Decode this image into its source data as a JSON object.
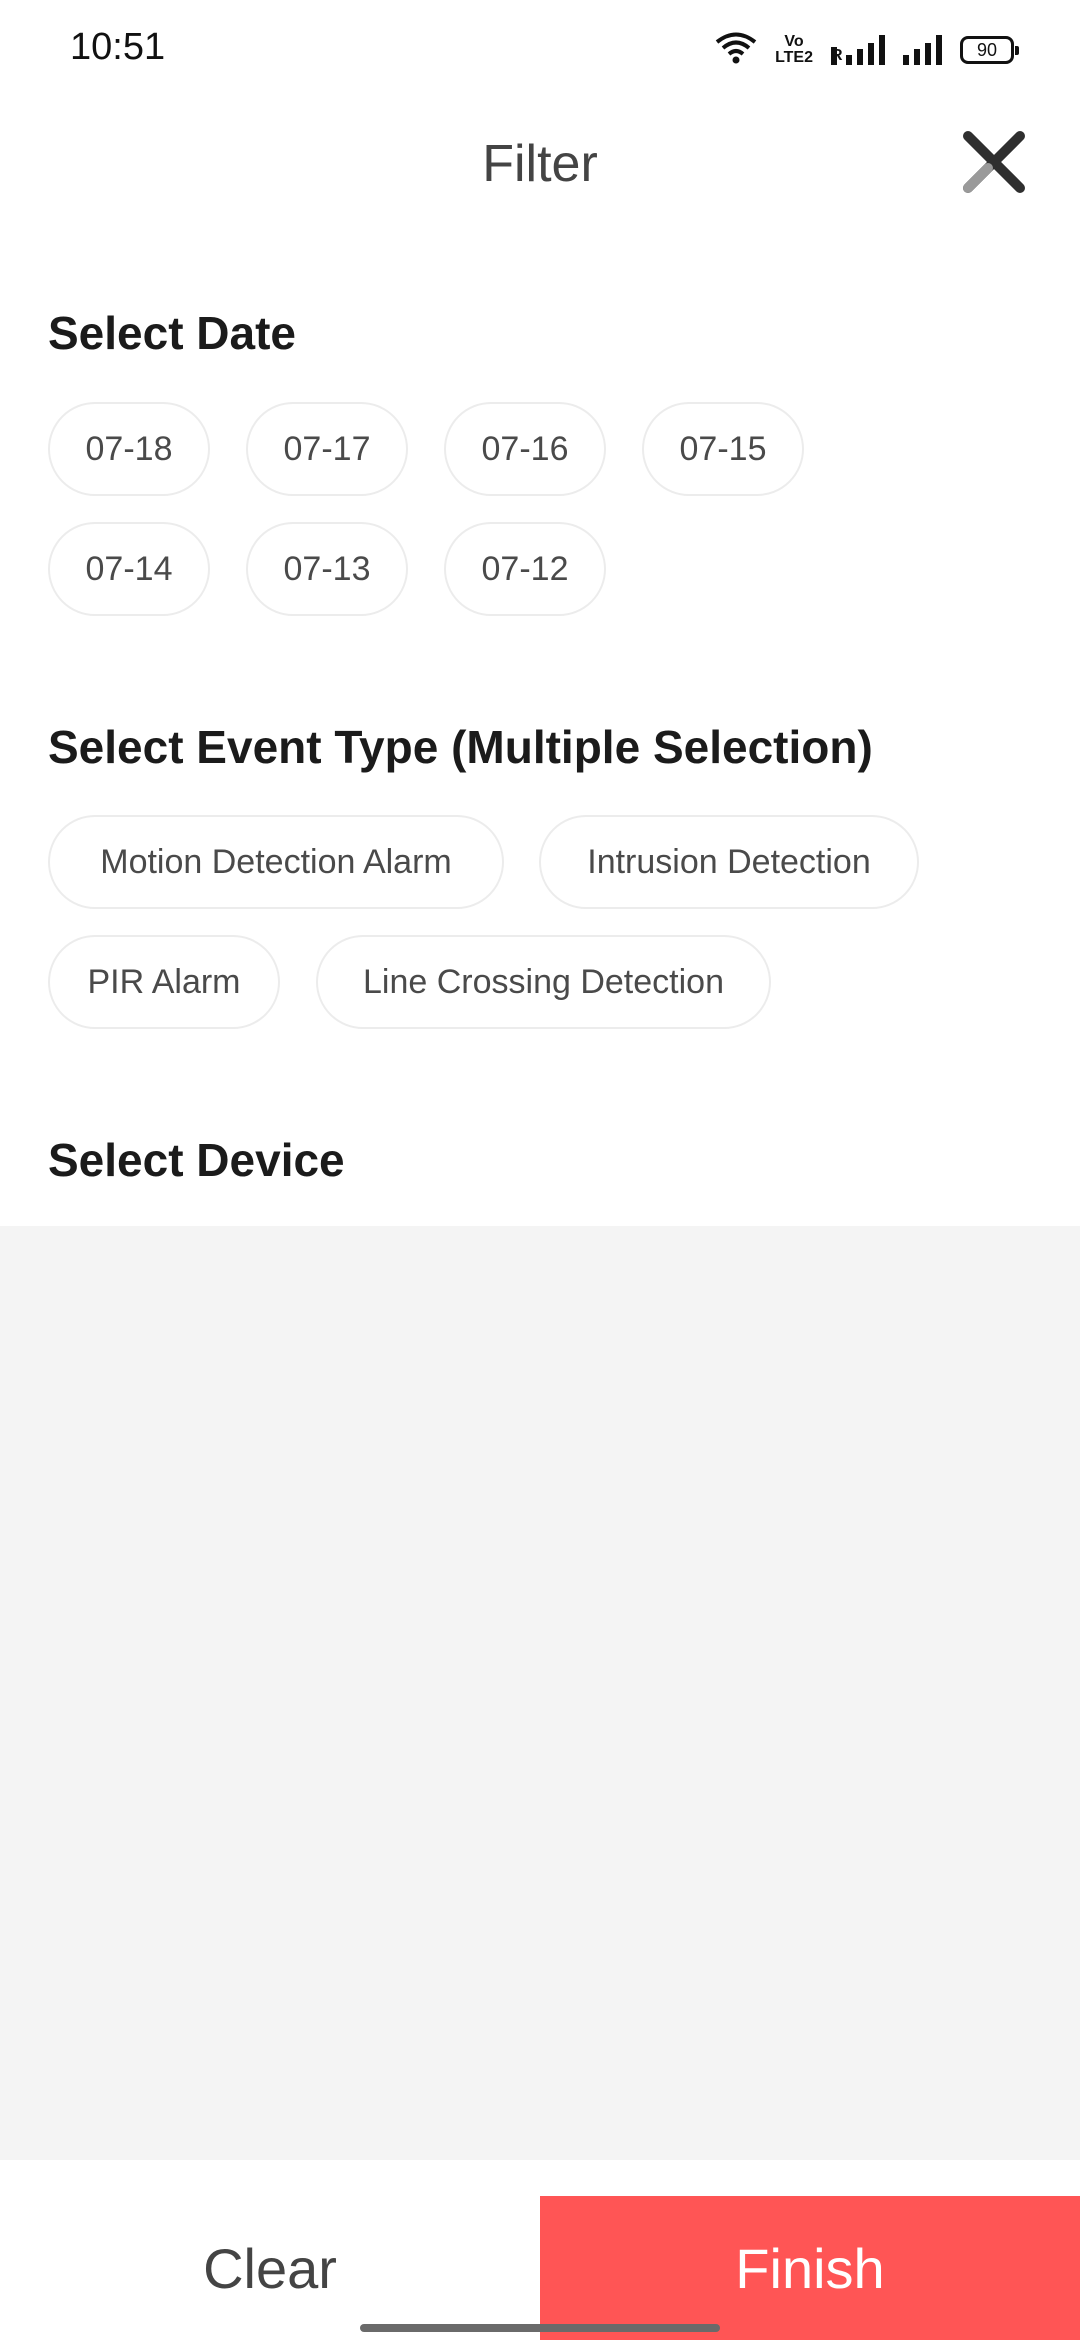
{
  "status_bar": {
    "time": "10:51",
    "volte_top": "Vo",
    "volte_bottom": "LTE2",
    "roaming": "R",
    "battery": "90",
    "icons": [
      "wifi-icon",
      "volte-icon",
      "signal-icon",
      "signal-icon",
      "battery-icon"
    ]
  },
  "header": {
    "title": "Filter",
    "close_icon": "close-icon"
  },
  "date_section": {
    "title": "Select Date",
    "dates": [
      "07-18",
      "07-17",
      "07-16",
      "07-15",
      "07-14",
      "07-13",
      "07-12"
    ]
  },
  "event_section": {
    "title": "Select Event Type (Multiple Selection)",
    "types": [
      "Motion Detection Alarm",
      "Intrusion Detection",
      "PIR Alarm",
      "Line Crossing Detection"
    ]
  },
  "device_section": {
    "title": "Select Device"
  },
  "footer": {
    "clear_label": "Clear",
    "finish_label": "Finish",
    "finish_color": "#ff5555"
  }
}
